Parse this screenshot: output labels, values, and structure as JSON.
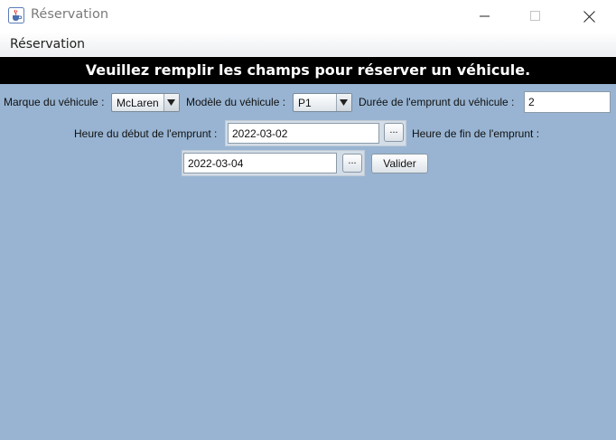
{
  "window": {
    "title": "Réservation",
    "icon": "java-cup-icon"
  },
  "window_controls": {
    "minimize": "minimize-icon",
    "maximize": "maximize-icon",
    "close": "close-icon"
  },
  "menu": {
    "items": [
      "Réservation"
    ]
  },
  "banner": "Veuillez remplir les champs pour réserver un véhicule.",
  "form": {
    "brand_label": "Marque du véhicule :",
    "brand_value": "McLaren",
    "model_label": "Modèle du véhicule :",
    "model_value": "P1",
    "duration_label": "Durée de l'emprunt du véhicule :",
    "duration_value": "2",
    "start_label": "Heure du début de l'emprunt :",
    "start_value": "2022-03-02",
    "start_button": "...",
    "end_label": "Heure de fin de l'emprunt :",
    "end_value": "2022-03-04",
    "end_button": "...",
    "submit_label": "Valider"
  },
  "colors": {
    "content_bg": "#98b4d2",
    "banner_bg": "#000000",
    "banner_text": "#ffffff"
  }
}
